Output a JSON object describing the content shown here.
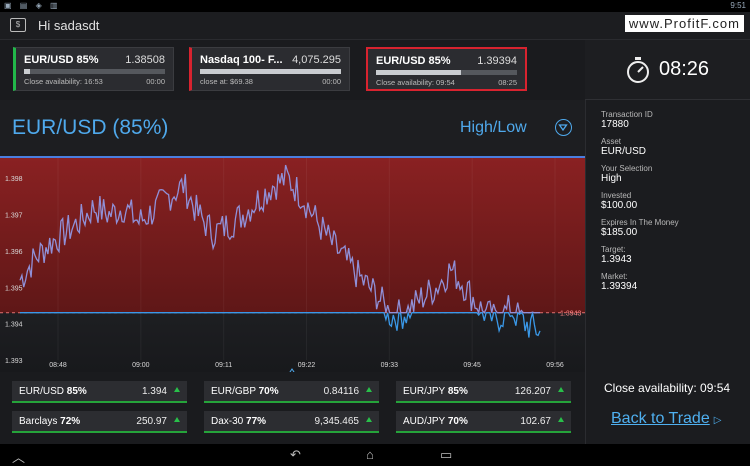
{
  "status": {
    "time": "9:51"
  },
  "app": {
    "title": "Hi sadasdt"
  },
  "watermark": "www.ProfitF.com",
  "tickers": [
    {
      "symbol": "EUR/USD 85%",
      "price": "1.38508",
      "sub": "Close availability: 16:53",
      "time": "00:00",
      "accent": "#22b84a",
      "progress": 0.04
    },
    {
      "symbol": "Nasdaq 100- F...",
      "price": "4,075.295",
      "sub": "close at: $69.38",
      "time": "00:00",
      "accent": "#d8232f",
      "progress": 1.0
    },
    {
      "symbol": "EUR/USD 85%",
      "price": "1.39394",
      "sub": "Close availability: 09:54",
      "time": "08:25",
      "accent": "#d8232f",
      "progress": 0.6
    }
  ],
  "clock": "08:26",
  "transaction": [
    {
      "label": "Transaction ID",
      "value": "17880"
    },
    {
      "label": "Asset",
      "value": "EUR/USD"
    },
    {
      "label": "Your Selection",
      "value": "High"
    },
    {
      "label": "Invested",
      "value": "$100.00"
    },
    {
      "label": "Expires In The Money",
      "value": "$185.00"
    },
    {
      "label": "Target:",
      "value": "1.3943"
    },
    {
      "label": "Market:",
      "value": "1.39394"
    }
  ],
  "close_availability": "Close availability: 09:54",
  "back_to_trade": "Back to Trade",
  "chart_header": {
    "asset": "EUR/USD (85%)",
    "mode": "High/Low"
  },
  "chart_data": {
    "type": "line",
    "x_ticks": [
      "08:48",
      "09:00",
      "09:11",
      "09:22",
      "09:33",
      "09:45",
      "09:56"
    ],
    "y_ticks": [
      "1.398",
      "1.397",
      "1.396",
      "1.395",
      "1.394",
      "1.393"
    ],
    "ylim": [
      1.393,
      1.3985
    ],
    "target_label": "1.3943",
    "target": 1.3943,
    "x": [
      0,
      2,
      4,
      6,
      8,
      10,
      12,
      14,
      16,
      18,
      20,
      22,
      24,
      26,
      28,
      30,
      32,
      34,
      36,
      38,
      40,
      42,
      44,
      46,
      48,
      50,
      52,
      54,
      56,
      58,
      60,
      62,
      64,
      66,
      68,
      70
    ],
    "values": [
      1.3952,
      1.3958,
      1.3962,
      1.3965,
      1.3968,
      1.3972,
      1.397,
      1.3972,
      1.3968,
      1.3971,
      1.3975,
      1.3978,
      1.397,
      1.3965,
      1.3967,
      1.397,
      1.3974,
      1.3978,
      1.398,
      1.3975,
      1.3968,
      1.3962,
      1.3957,
      1.3952,
      1.3948,
      1.3942,
      1.3943,
      1.3947,
      1.395,
      1.3955,
      1.395,
      1.3944,
      1.3941,
      1.3944,
      1.394,
      1.3938
    ],
    "colors": {
      "above": "#9090d8",
      "below": "#3a98e8",
      "bg_above": "#7d1f20"
    }
  },
  "quotes": [
    {
      "name": "EUR/USD",
      "pct": "85%",
      "price": "1.394"
    },
    {
      "name": "EUR/GBP",
      "pct": "70%",
      "price": "0.84116"
    },
    {
      "name": "EUR/JPY",
      "pct": "85%",
      "price": "126.207"
    },
    {
      "name": "Barclays",
      "pct": "72%",
      "price": "250.97"
    },
    {
      "name": "Dax-30",
      "pct": "77%",
      "price": "9,345.465"
    },
    {
      "name": "AUD/JPY",
      "pct": "70%",
      "price": "102.67"
    }
  ]
}
